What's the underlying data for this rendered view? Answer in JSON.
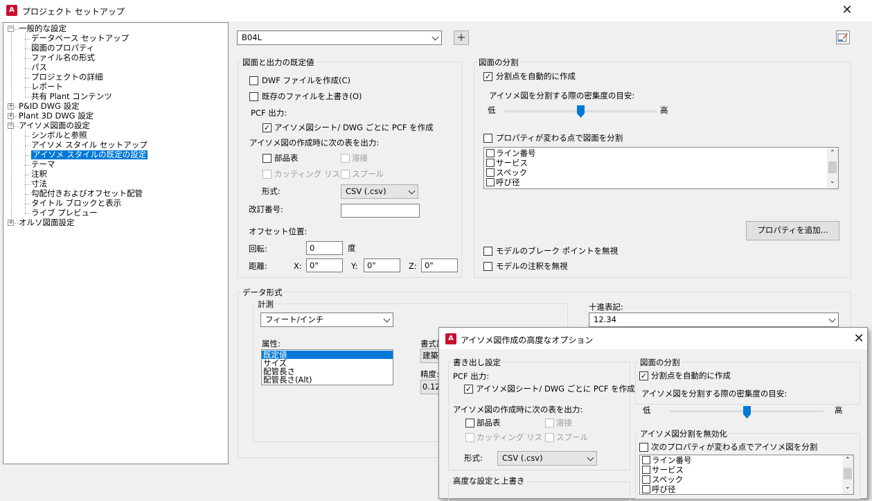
{
  "window": {
    "title": "プロジェクト セットアップ"
  },
  "tree": [
    {
      "label": "一般的な設定",
      "level": 0,
      "expander": "−"
    },
    {
      "label": "データベース セットアップ",
      "level": 1
    },
    {
      "label": "図面のプロパティ",
      "level": 1
    },
    {
      "label": "ファイル名の形式",
      "level": 1
    },
    {
      "label": "パス",
      "level": 1
    },
    {
      "label": "プロジェクトの詳細",
      "level": 1
    },
    {
      "label": "レポート",
      "level": 1
    },
    {
      "label": "共有 Plant コンテンツ",
      "level": 1
    },
    {
      "label": "P&ID DWG 設定",
      "level": 0,
      "expander": "+"
    },
    {
      "label": "Plant 3D DWG 設定",
      "level": 0,
      "expander": "+"
    },
    {
      "label": "アイソメ図面の設定",
      "level": 0,
      "expander": "−"
    },
    {
      "label": "シンボルと参照",
      "level": 1
    },
    {
      "label": "アイソメ スタイル セットアップ",
      "level": 1
    },
    {
      "label": "アイソメ スタイルの既定の設定",
      "level": 1,
      "selected": true
    },
    {
      "label": "テーマ",
      "level": 1
    },
    {
      "label": "注釈",
      "level": 1
    },
    {
      "label": "寸法",
      "level": 1
    },
    {
      "label": "勾配付きおよびオフセット配管",
      "level": 1
    },
    {
      "label": "タイトル ブロックと表示",
      "level": 1
    },
    {
      "label": "ライブ プレビュー",
      "level": 1
    },
    {
      "label": "オルソ図面設定",
      "level": 0,
      "expander": "+"
    }
  ],
  "style_select": {
    "value": "B04L"
  },
  "add_button": {
    "label": "+"
  },
  "drawing_output": {
    "title": "図面と出力の既定値",
    "dwf": {
      "label": "DWF ファイルを作成(C)",
      "checked": false
    },
    "overwrite": {
      "label": "既存のファイルを上書き(O)",
      "checked": false
    },
    "pcf_label": "PCF 出力:",
    "pcf_each": {
      "label": "アイソメ図シート/ DWG ごとに PCF を作成",
      "checked": true
    },
    "tables_label": "アイソメ図の作成時に次の表を出力:",
    "bom": {
      "label": "部品表",
      "checked": false
    },
    "weld": {
      "label": "溶接",
      "checked": false
    },
    "cut": {
      "label": "カッティング リスト",
      "checked": false
    },
    "spool": {
      "label": "スプール",
      "checked": false
    },
    "format_label": "形式:",
    "format_value": "CSV (.csv)",
    "revision_label": "改訂番号:",
    "revision_value": "",
    "offset_label": "オフセット位置:",
    "rotation_label": "回転:",
    "rotation_value": "0",
    "degree_label": "度",
    "distance_label": "距離:",
    "x_label": "X:",
    "x_value": "0\"",
    "y_label": "Y:",
    "y_value": "0\"",
    "z_label": "Z:",
    "z_value": "0\""
  },
  "split": {
    "title": "図面の分割",
    "auto": {
      "label": "分割点を自動的に作成",
      "checked": true
    },
    "density_label": "アイソメ図を分割する際の密集度の目安:",
    "low": "低",
    "high": "高",
    "density_level": 0.5,
    "prop_split": {
      "label": "プロパティが変わる点で図面を分割",
      "checked": false
    },
    "props": [
      "ライン番号",
      "サービス",
      "スペック",
      "呼び径"
    ],
    "add_prop_button": "プロパティを追加...",
    "ignore_break": {
      "label": "モデルのブレーク ポイントを無視",
      "checked": false
    },
    "ignore_annot": {
      "label": "モデルの注釈を無視",
      "checked": false
    }
  },
  "data_format": {
    "title": "データ形式",
    "measure_title": "計測",
    "measure_value": "フィート/インチ",
    "decimal_label": "十進表記:",
    "decimal_value": "12.34",
    "attr_label": "属性:",
    "attributes": [
      "既定値",
      "サイズ",
      "配管長さ",
      "配管長さ(Alt)"
    ],
    "format_label": "書式設",
    "format_value": "建築",
    "precision_label": "精度:",
    "precision_value": "0.12"
  },
  "advanced": {
    "title": "アイソメ図作成の高度なオプション",
    "export_title": "書き出し設定",
    "pcf_label": "PCF 出力:",
    "pcf_each": {
      "label": "アイソメ図シート/ DWG ごとに PCF を作成",
      "checked": true
    },
    "tables_label": "アイソメ図の作成時に次の表を出力:",
    "bom": "部品表",
    "weld": "溶接",
    "cut": "カッティング リスト",
    "spool": "スプール",
    "format_label": "形式:",
    "format_value": "CSV (.csv)",
    "advanced_title": "高度な設定と上書き",
    "split_title": "図面の分割",
    "auto_label": "分割点を自動的に作成",
    "density_label": "アイソメ図を分割する際の密集度の目安:",
    "low": "低",
    "high": "高",
    "density_level": 0.5,
    "disable_title": "アイソメ図分割を無効化",
    "prop_split_label": "次のプロパティが変わる点でアイソメ図を分割",
    "props": [
      "ライン番号",
      "サービス",
      "スペック",
      "呼び径"
    ]
  }
}
